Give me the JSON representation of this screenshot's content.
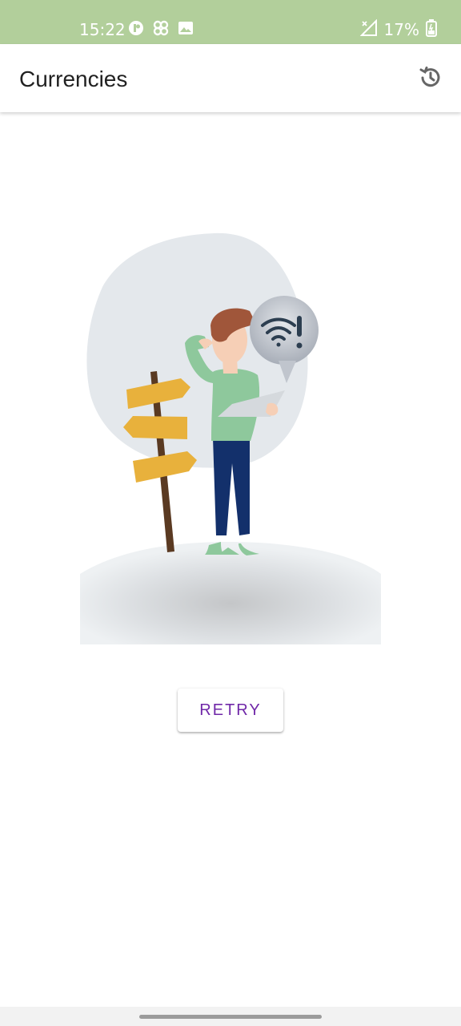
{
  "status_bar": {
    "time": "15:22",
    "battery": "17%",
    "background": "#b2cf9b"
  },
  "app_bar": {
    "title": "Currencies",
    "action_icon": "history-icon"
  },
  "illustration": {
    "subject": "no-connection-illustration",
    "bubble_icon": "wifi-alert-icon"
  },
  "actions": {
    "retry_label": "RETRY",
    "retry_color": "#7028a8"
  }
}
